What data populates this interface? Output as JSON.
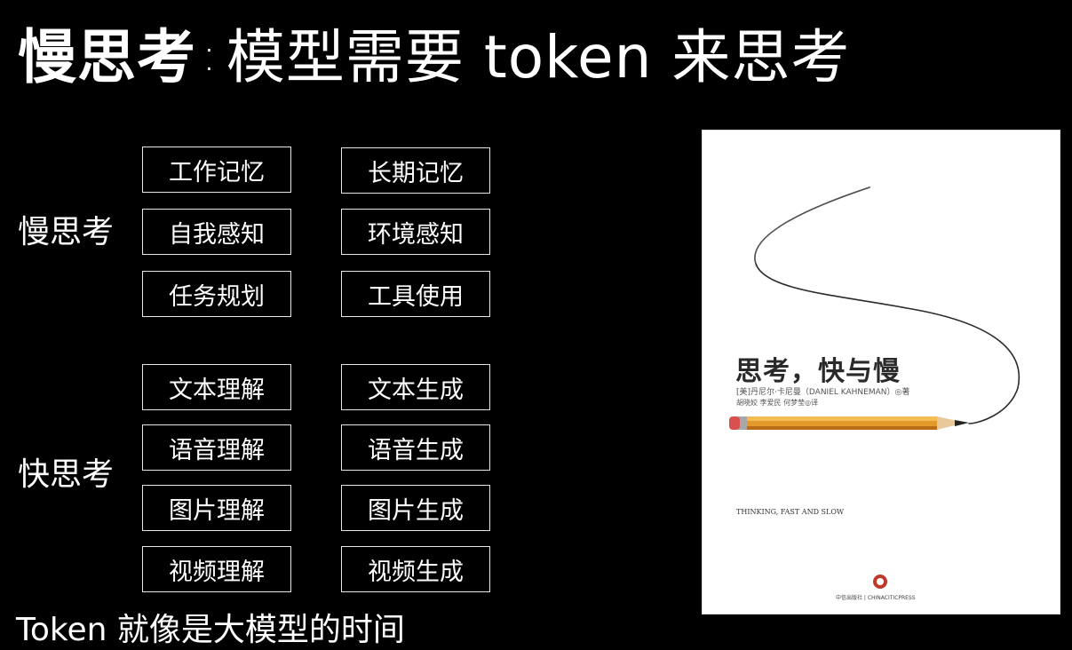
{
  "slide": {
    "title_bold": "慢思考",
    "title_colon": ":",
    "title_rest": "模型需要 token 来思考",
    "footer": "Token 就像是大模型的时间"
  },
  "slow_thinking": {
    "label": "慢思考",
    "items": [
      "工作记忆",
      "长期记忆",
      "自我感知",
      "环境感知",
      "任务规划",
      "工具使用"
    ]
  },
  "fast_thinking": {
    "label": "快思考",
    "items": [
      "文本理解",
      "文本生成",
      "语音理解",
      "语音生成",
      "图片理解",
      "图片生成",
      "视频理解",
      "视频生成"
    ]
  },
  "book_cover": {
    "title": "思考，快与慢",
    "author_line": "[美]丹尼尔·卡尼曼（DANIEL KAHNEMAN）◎著",
    "translators_line": "胡晓姣  李爱民  何梦莹◎译",
    "english_title": "THINKING, FAST AND SLOW",
    "publisher": "中信出版社 | CHINACITICPRESS"
  }
}
